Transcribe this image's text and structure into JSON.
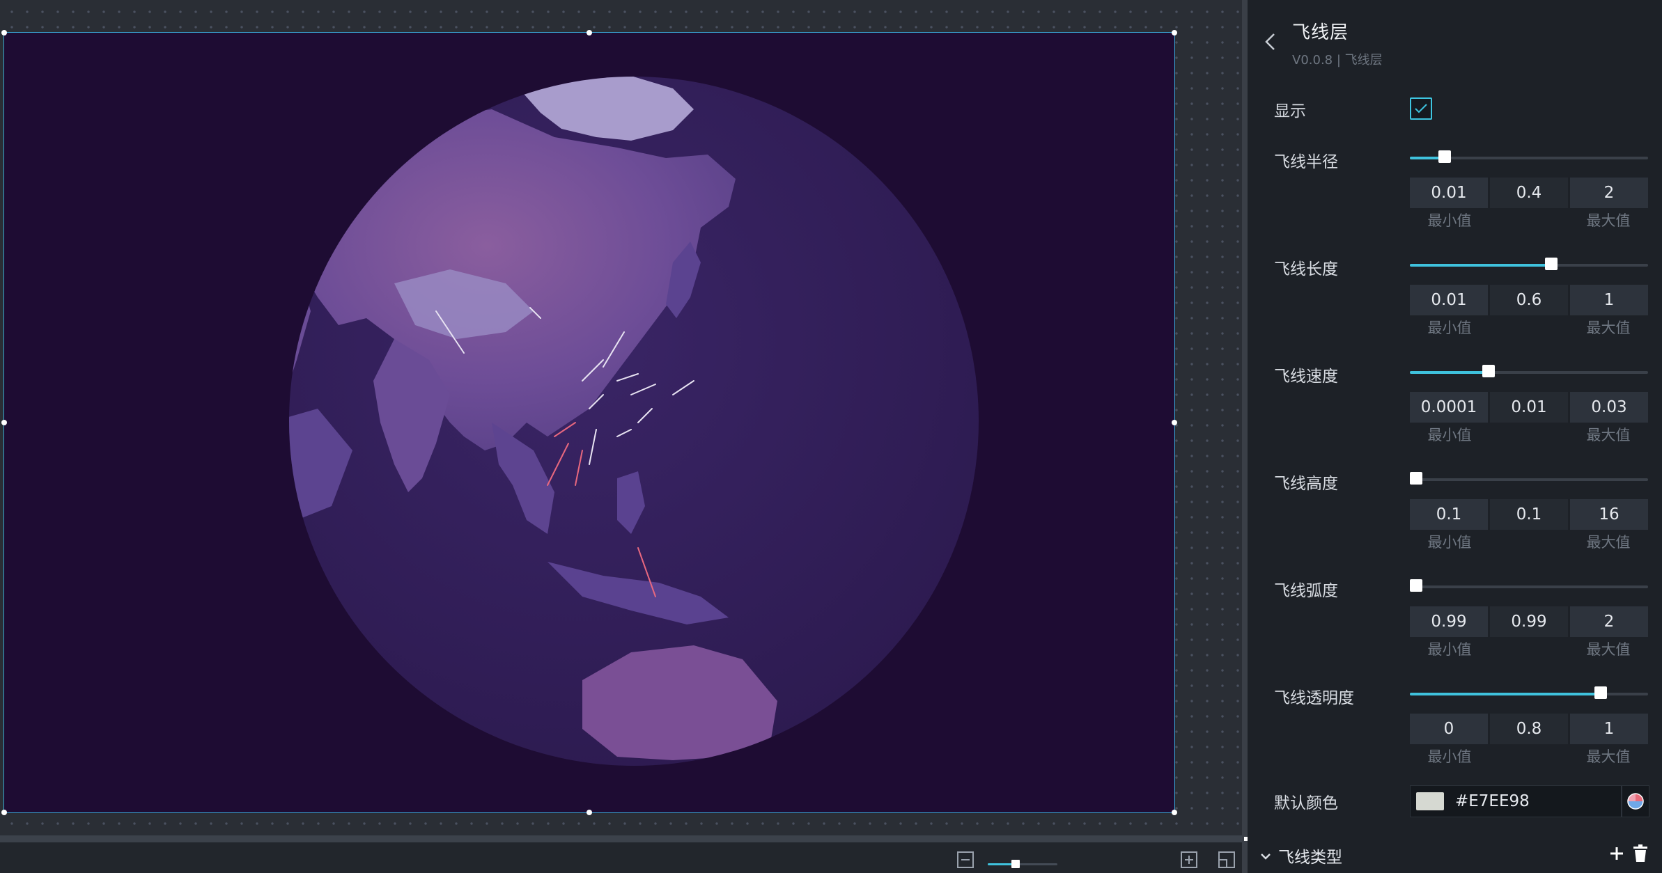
{
  "panel": {
    "title": "飞线层",
    "subtitle": "V0.0.8 | 飞线层",
    "visible_label": "显示",
    "visible_checked": true,
    "properties": [
      {
        "label": "飞线半径",
        "min": "0.01",
        "value": "0.4",
        "max": "2",
        "fraction": 0.145,
        "min_caption": "最小值",
        "max_caption": "最大值"
      },
      {
        "label": "飞线长度",
        "min": "0.01",
        "value": "0.6",
        "max": "1",
        "fraction": 0.595,
        "min_caption": "最小值",
        "max_caption": "最大值"
      },
      {
        "label": "飞线速度",
        "min": "0.0001",
        "value": "0.01",
        "max": "0.03",
        "fraction": 0.33,
        "min_caption": "最小值",
        "max_caption": "最大值"
      },
      {
        "label": "飞线高度",
        "min": "0.1",
        "value": "0.1",
        "max": "16",
        "fraction": 0.0,
        "min_caption": "最小值",
        "max_caption": "最大值"
      },
      {
        "label": "飞线弧度",
        "min": "0.99",
        "value": "0.99",
        "max": "2",
        "fraction": 0.0,
        "min_caption": "最小值",
        "max_caption": "最大值"
      },
      {
        "label": "飞线透明度",
        "min": "0",
        "value": "0.8",
        "max": "1",
        "fraction": 0.8,
        "min_caption": "最小值",
        "max_caption": "最大值"
      }
    ],
    "default_color_label": "默认颜色",
    "default_color_value": "#E7EE98",
    "default_color_swatch": "#D6D9D2",
    "flight_type_label": "飞线类型",
    "icons": {
      "back": "chevron-left-icon",
      "collapse": "caret-down-icon",
      "add": "plus-icon",
      "delete": "trash-icon",
      "picker": "color-picker-icon"
    }
  },
  "toolbar": {
    "zoom_fraction": 0.4,
    "icons": [
      "zoom-out-icon",
      "zoom-in-icon",
      "fit-screen-icon"
    ]
  },
  "colors": {
    "accent": "#3FC2DD",
    "artboard_bg": "#1E0C33",
    "globe_ocean": "#33205A",
    "land": "#5A3E8A",
    "flight_line_pink": "#E8687F",
    "flight_line_white": "#E8E3F2"
  }
}
